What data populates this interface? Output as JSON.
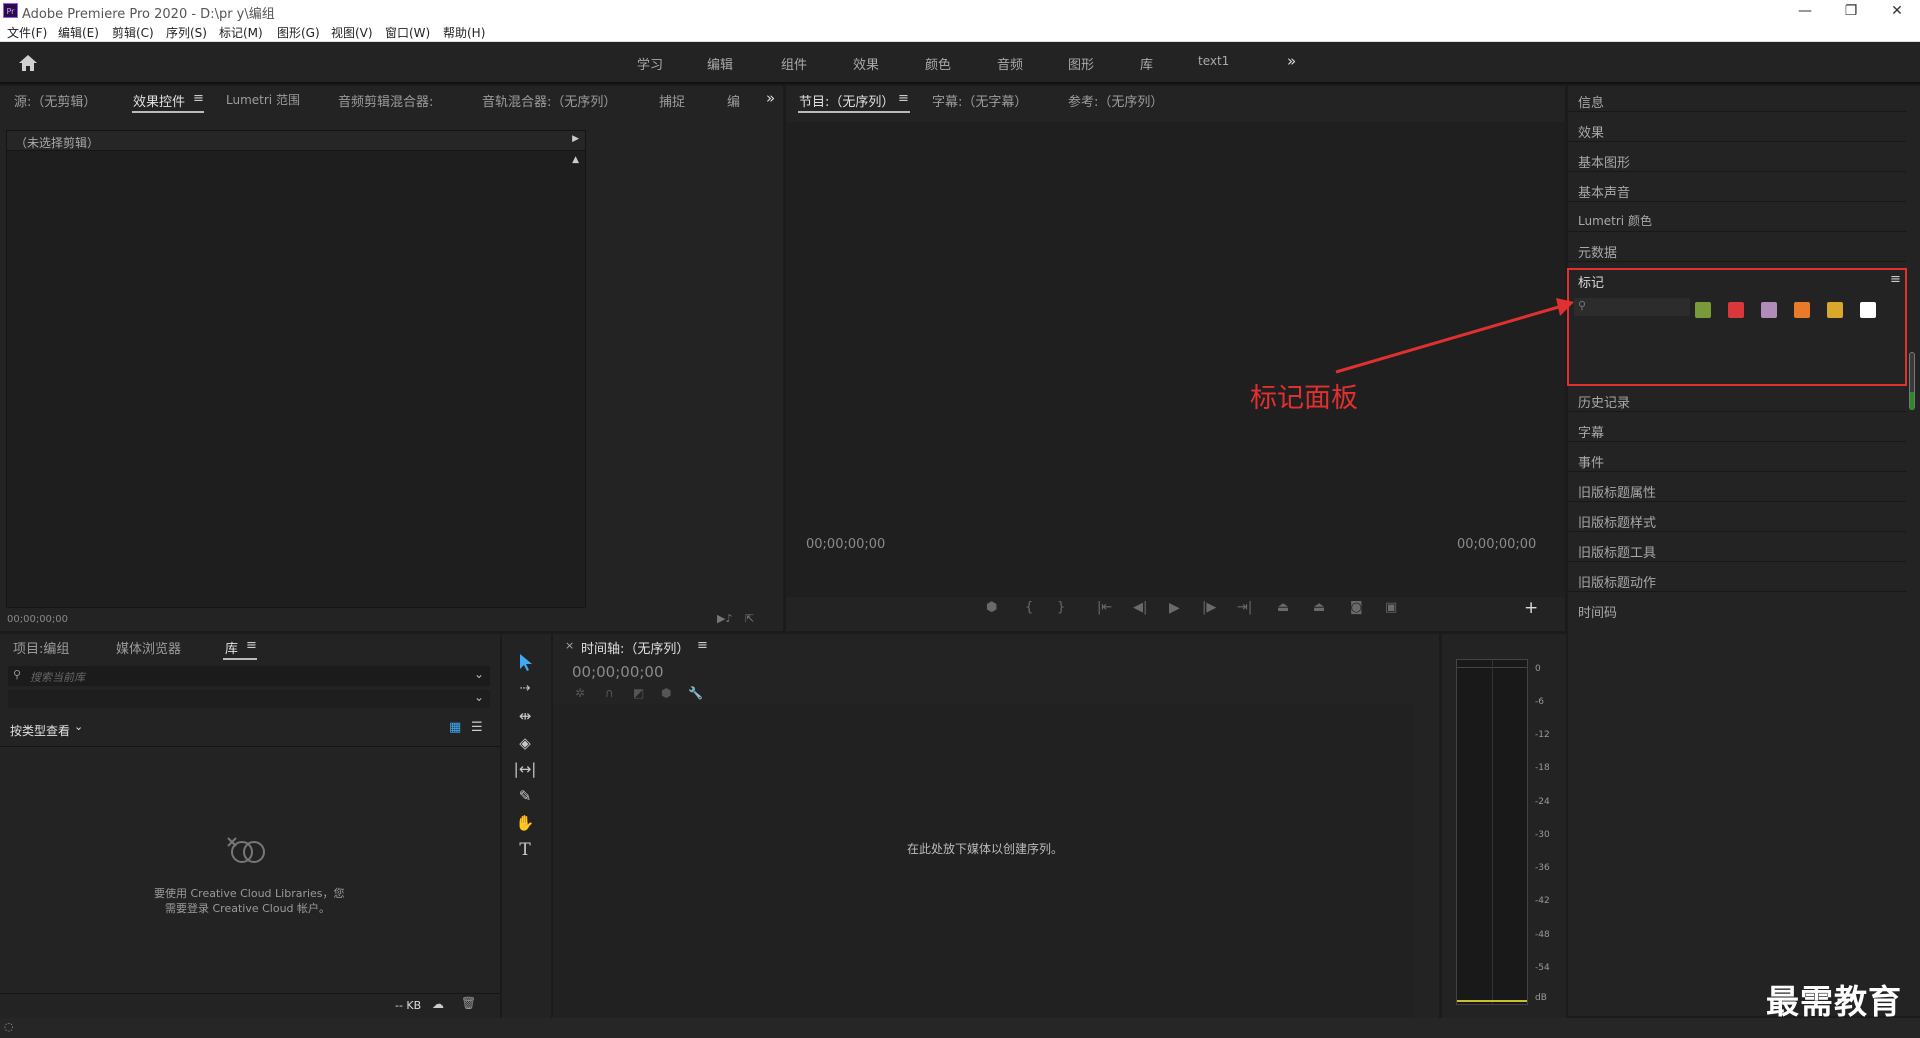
{
  "window": {
    "title": "Adobe Premiere Pro 2020 - D:\\pr y\\编组",
    "logo": "Pr"
  },
  "menu": [
    "文件(F)",
    "编辑(E)",
    "剪辑(C)",
    "序列(S)",
    "标记(M)",
    "图形(G)",
    "视图(V)",
    "窗口(W)",
    "帮助(H)"
  ],
  "workspaces": [
    "学习",
    "编辑",
    "组件",
    "效果",
    "颜色",
    "音频",
    "图形",
    "库",
    "text1"
  ],
  "source_panel": {
    "tabs": [
      "源:（无剪辑）",
      "效果控件",
      "Lumetri 范围",
      "音频剪辑混合器:",
      "音轨混合器:（无序列）",
      "捕捉",
      "编"
    ],
    "active_tab": "效果控件",
    "no_clip": "（未选择剪辑）",
    "timecode": "00;00;00;00"
  },
  "program_panel": {
    "tabs": [
      "节目:（无序列）",
      "字幕:（无字幕）",
      "参考:（无序列）"
    ],
    "timecode_left": "00;00;00;00",
    "timecode_right": "00;00;00;00"
  },
  "right_panel": {
    "items_top": [
      "信息",
      "效果",
      "基本图形",
      "基本声音",
      "Lumetri 颜色",
      "元数据"
    ],
    "markers": {
      "title": "标记",
      "colors": [
        "#7a9a3a",
        "#d9373b",
        "#b28cb8",
        "#e87a2a",
        "#d9a82a",
        "#ffffff"
      ]
    },
    "items_bottom": [
      "历史记录",
      "字幕",
      "事件",
      "旧版标题属性",
      "旧版标题样式",
      "旧版标题工具",
      "旧版标题动作",
      "时间码"
    ]
  },
  "annotation": {
    "label": "标记面板",
    "color": "#e03030"
  },
  "project_panel": {
    "tabs": [
      "项目:编组",
      "媒体浏览器",
      "库"
    ],
    "active_tab": "库",
    "search_placeholder": "搜索当前库",
    "view_by": "按类型查看",
    "cc_message_line1": "要使用 Creative Cloud Libraries，您",
    "cc_message_line2": "需要登录 Creative Cloud 帐户。",
    "storage": "-- KB"
  },
  "tools": [
    "selection-tool",
    "track-select-tool",
    "ripple-edit-tool",
    "razor-tool",
    "slip-tool",
    "pen-tool",
    "hand-tool",
    "type-tool"
  ],
  "timeline": {
    "title": "时间轴:（无序列）",
    "timecode": "00;00;00;00",
    "drop_hint": "在此处放下媒体以创建序列。"
  },
  "audio_meter": {
    "labels": [
      "0",
      "-6",
      "-12",
      "-18",
      "-24",
      "-30",
      "-36",
      "-42",
      "-48",
      "-54",
      "dB"
    ]
  },
  "watermark": "最需教育"
}
